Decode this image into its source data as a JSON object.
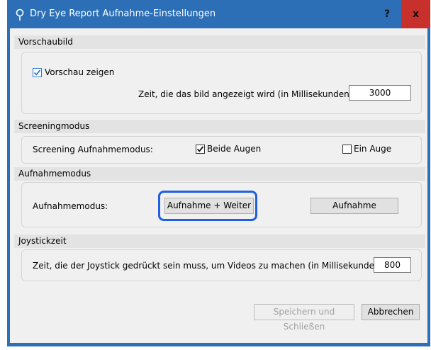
{
  "window": {
    "title": "Dry Eye Report Aufnahme-Einstellungen",
    "help_label": "?",
    "close_label": "x"
  },
  "preview": {
    "header": "Vorschaubild",
    "show_label": "Vorschau zeigen",
    "show_checked": true,
    "time_label": "Zeit, die das bild angezeigt wird (in Millisekunden):",
    "time_value": "3000"
  },
  "screening": {
    "header": "Screeningmodus",
    "mode_label": "Screening Aufnahmemodus:",
    "both_eyes_label": "Beide Augen",
    "both_eyes_checked": true,
    "one_eye_label": "Ein Auge",
    "one_eye_checked": false
  },
  "capture": {
    "header": "Aufnahmemodus",
    "mode_label": "Aufnahmemodus:",
    "continue_button": "Aufnahme + Weiter",
    "capture_button": "Aufnahme"
  },
  "joystick": {
    "header": "Joystickzeit",
    "time_label": "Zeit, die der Joystick gedrückt sein muss, um Videos zu machen (in Millisekunden):",
    "time_value": "800"
  },
  "footer": {
    "save_close_button": "Speichern und Schließen",
    "cancel_button": "Abbrechen"
  },
  "colors": {
    "titlebar": "#2c6fb6",
    "close": "#c7302b",
    "highlight": "#1f5fe0"
  }
}
